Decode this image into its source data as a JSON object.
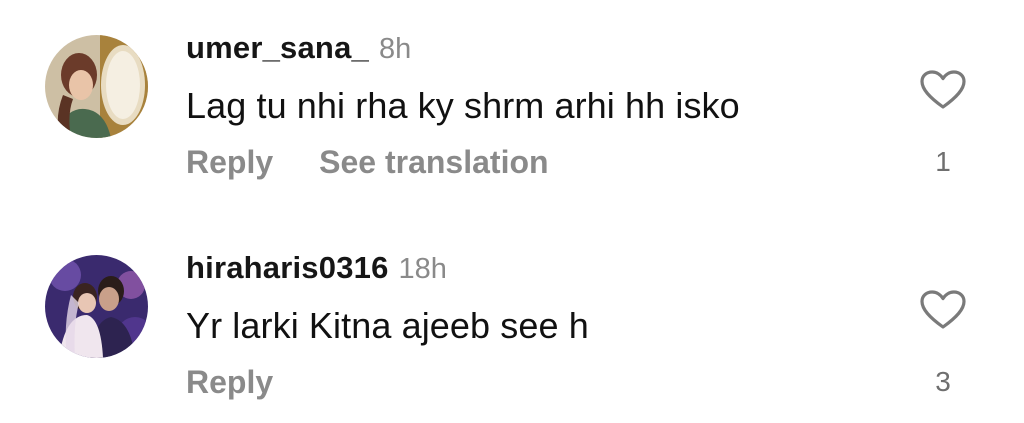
{
  "comments": [
    {
      "username": "umer_sana_",
      "time": "8h",
      "text": "Lag tu nhi rha ky shrm arhi hh isko",
      "reply_label": "Reply",
      "translate_label": "See translation",
      "likes": "1",
      "avatar_icon": "profile-photo"
    },
    {
      "username": "hiraharis0316",
      "time": "18h",
      "text": "Yr larki Kitna ajeeb see h",
      "reply_label": "Reply",
      "likes": "3",
      "avatar_icon": "profile-photo"
    }
  ],
  "icons": {
    "like": "heart-outline-icon"
  },
  "colors": {
    "username": "#161616",
    "meta": "#8a8a8a",
    "text": "#111111",
    "like_count": "#6f6f6f"
  }
}
